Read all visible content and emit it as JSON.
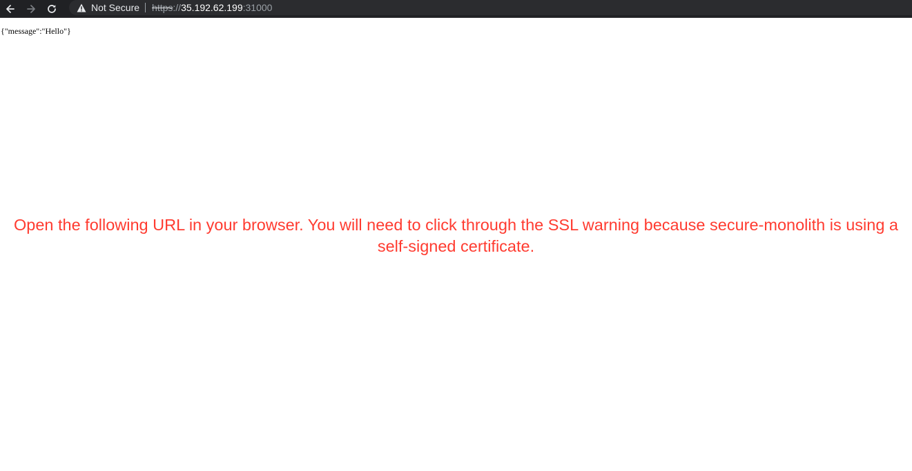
{
  "browser": {
    "security_label": "Not Secure",
    "url_scheme": "https",
    "url_separator": "://",
    "url_host": "35.192.62.199",
    "url_port": ":31000"
  },
  "page": {
    "body_text": "{\"message\":\"Hello\"}"
  },
  "overlay": {
    "caption": "Open the following URL in your browser. You will need to click through the SSL warning because secure-monolith is using a self-signed certificate."
  },
  "colors": {
    "toolbar_bg": "#202124",
    "caption_color": "#ff3b30"
  },
  "icons": [
    "back-arrow-icon",
    "forward-arrow-icon",
    "reload-icon",
    "warning-icon"
  ]
}
